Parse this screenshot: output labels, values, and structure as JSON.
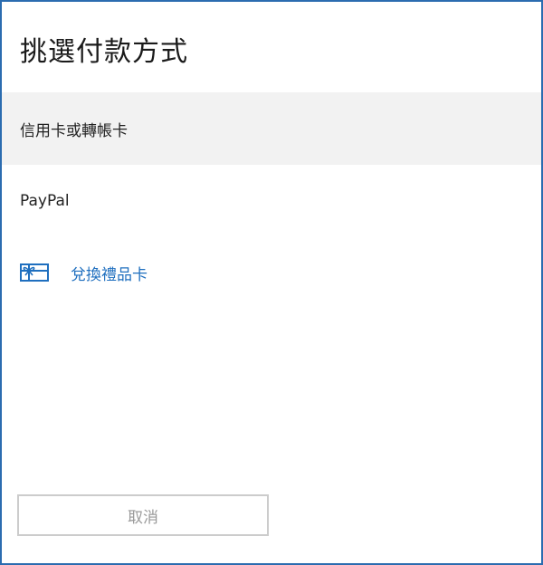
{
  "dialog": {
    "title": "挑選付款方式",
    "options": [
      {
        "label": "信用卡或轉帳卡",
        "selected": true
      },
      {
        "label": "PayPal",
        "selected": false
      }
    ],
    "gift_card": {
      "label": "兌換禮品卡",
      "icon": "gift-card-icon"
    },
    "cancel_label": "取消"
  },
  "colors": {
    "accent": "#1f6fbf",
    "frame": "#2b6cb0",
    "selected_background": "#f2f2f2",
    "disabled_text": "#9a9a9a"
  }
}
